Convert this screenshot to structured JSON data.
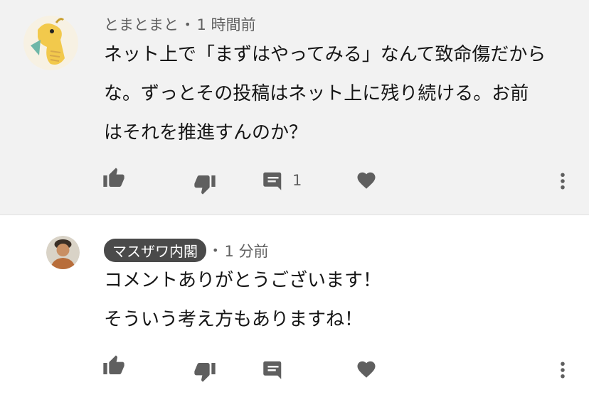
{
  "comments": [
    {
      "author": "とまとまと",
      "time": "1 時間前",
      "lines": [
        "ネット上で「まずはやってみる」なんて致命傷だから",
        "な。ずっとその投稿はネット上に残り続ける。お前",
        "はそれを推進すんのか？"
      ],
      "reply_count": "1",
      "icons": [
        "thumb-up-icon",
        "thumb-down-icon",
        "reply-icon",
        "heart-icon",
        "more-icon"
      ]
    },
    {
      "author": "マスザワ内閣",
      "time": "1 分前",
      "lines": [
        "コメントありがとうございます！",
        "そういう考え方もありますね！"
      ],
      "icons": [
        "thumb-up-icon",
        "thumb-down-icon",
        "reply-icon",
        "heart-icon",
        "more-icon"
      ]
    }
  ],
  "colors": {
    "top_bg": "#f2f2f2",
    "icon": "#5f5f5f",
    "badge_bg": "#4a4a4a"
  }
}
